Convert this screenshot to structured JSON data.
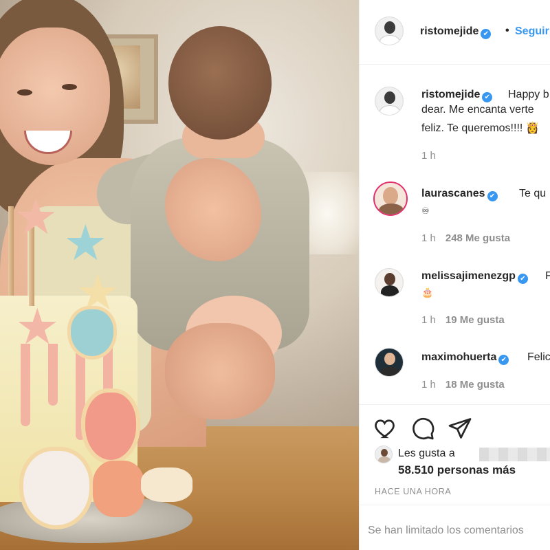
{
  "post": {
    "author": "ristomejide",
    "follow_label": "Seguir",
    "dot": "•",
    "verified_icon": "✔"
  },
  "comments": [
    {
      "user": "ristomejide",
      "lines": [
        "Happy b",
        "dear. Me encanta verte",
        "feliz. Te queremos!!!! 👸"
      ],
      "time": "1 h",
      "likes": ""
    },
    {
      "user": "laurascanes",
      "lines": [
        "Te qu",
        "♾"
      ],
      "time": "1 h",
      "likes": "248 Me gusta"
    },
    {
      "user": "melissajimenezgp",
      "lines": [
        "F",
        "🎂"
      ],
      "time": "1 h",
      "likes": "19 Me gusta"
    },
    {
      "user": "maximohuerta",
      "lines": [
        "Felic"
      ],
      "time": "1 h",
      "likes": "18 Me gusta"
    }
  ],
  "actions": {
    "like_icon": "heart-icon",
    "comment_icon": "comment-icon",
    "share_icon": "share-icon"
  },
  "likes": {
    "prefix": "Les gusta a",
    "count": "58.510 personas más"
  },
  "timestamp": "HACE UNA HORA",
  "limited_comments": "Se han limitado los comentarios",
  "colors": {
    "accent": "#3897f0",
    "text": "#262626",
    "muted": "#8e8e8e",
    "border": "#efefef"
  }
}
